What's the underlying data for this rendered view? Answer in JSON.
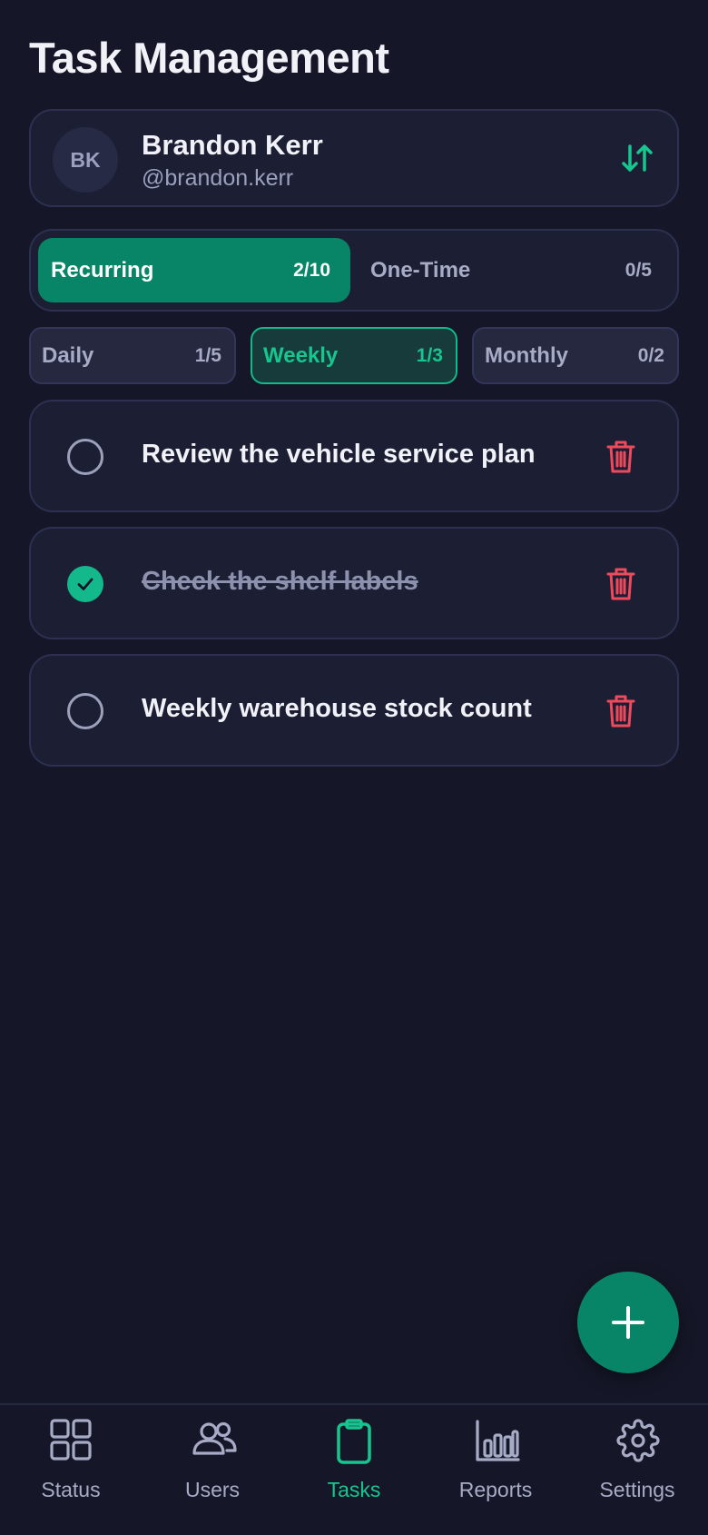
{
  "page": {
    "title": "Task Management"
  },
  "user": {
    "initials": "BK",
    "name": "Brandon Kerr",
    "handle": "@brandon.kerr"
  },
  "type_tabs": [
    {
      "label": "Recurring",
      "count": "2/10",
      "active": true
    },
    {
      "label": "One-Time",
      "count": "0/5",
      "active": false
    }
  ],
  "frequency_tabs": [
    {
      "label": "Daily",
      "count": "1/5",
      "active": false
    },
    {
      "label": "Weekly",
      "count": "1/3",
      "active": true
    },
    {
      "label": "Monthly",
      "count": "0/2",
      "active": false
    }
  ],
  "tasks": [
    {
      "text": "Review the vehicle service plan",
      "done": false
    },
    {
      "text": "Check the shelf labels",
      "done": true
    },
    {
      "text": "Weekly warehouse stock count",
      "done": false
    }
  ],
  "fab": {
    "icon": "plus-icon"
  },
  "bottom_nav": [
    {
      "label": "Status",
      "icon": "grid-icon",
      "active": false
    },
    {
      "label": "Users",
      "icon": "users-icon",
      "active": false
    },
    {
      "label": "Tasks",
      "icon": "clipboard-icon",
      "active": true
    },
    {
      "label": "Reports",
      "icon": "bar-chart-icon",
      "active": false
    },
    {
      "label": "Settings",
      "icon": "gear-icon",
      "active": false
    }
  ],
  "colors": {
    "background": "#151728",
    "card": "#1c1e33",
    "accent": "#078566",
    "accent_bright": "#17c58f",
    "danger": "#ef4a5c"
  }
}
